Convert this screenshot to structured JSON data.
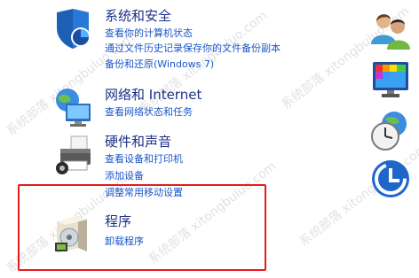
{
  "categories": {
    "system_security": {
      "title": "系统和安全",
      "links": [
        "查看你的计算机状态",
        "通过文件历史记录保存你的文件备份副本",
        "备份和还原(Windows 7)"
      ]
    },
    "network": {
      "title": "网络和 Internet",
      "links": [
        "查看网络状态和任务"
      ]
    },
    "hardware": {
      "title": "硬件和声音",
      "links": [
        "查看设备和打印机",
        "添加设备",
        "调整常用移动设置"
      ]
    },
    "programs": {
      "title": "程序",
      "links": [
        "卸载程序"
      ]
    }
  },
  "watermark": {
    "text": "系统部落 xitongbuluo.com"
  },
  "colors": {
    "title": "#1e3287",
    "link": "#1a56c8",
    "highlight": "#e41c1c"
  }
}
